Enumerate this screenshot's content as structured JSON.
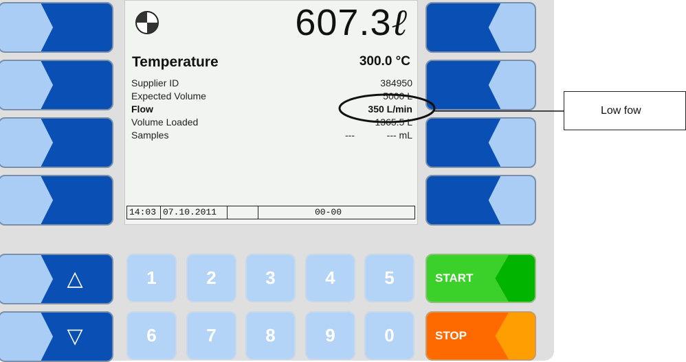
{
  "display": {
    "status_icon": "target-quadrant-icon",
    "volume_value": "607.3",
    "volume_unit": "ℓ",
    "title": "Temperature",
    "temperature": "300.0 °C",
    "rows": [
      {
        "label": "Supplier ID",
        "value": "384950",
        "bold": false
      },
      {
        "label": "Expected Volume",
        "value": "5000 L",
        "bold": false
      },
      {
        "label": "Flow",
        "value": "350 L/min",
        "bold": true
      },
      {
        "label": "Volume Loaded",
        "value": "1365.5 L",
        "bold": false
      },
      {
        "label": "Samples",
        "mid": "---",
        "value": "--- mL",
        "bold": false
      }
    ],
    "status_bar": {
      "time": "14:03",
      "date": "07.10.2011",
      "empty": "",
      "code": "00-00"
    }
  },
  "keys": {
    "up_icon": "up-triangle-icon",
    "up_glyph": "△",
    "down_icon": "down-triangle-icon",
    "down_glyph": "▽",
    "digits_row1": [
      "1",
      "2",
      "3",
      "4",
      "5"
    ],
    "digits_row2": [
      "6",
      "7",
      "8",
      "9",
      "0"
    ],
    "start_label": "START",
    "stop_label": "STOP"
  },
  "annotation": {
    "callout": "Low fow"
  },
  "colors": {
    "softkey_blue": "#0a4fb3",
    "softkey_light": "#a9cdf5",
    "digit_key": "#b3d3f7",
    "start_green": "#3cd12a",
    "start_dark": "#00b400",
    "stop_orange": "#ff6a00",
    "stop_light": "#ff9e00"
  }
}
